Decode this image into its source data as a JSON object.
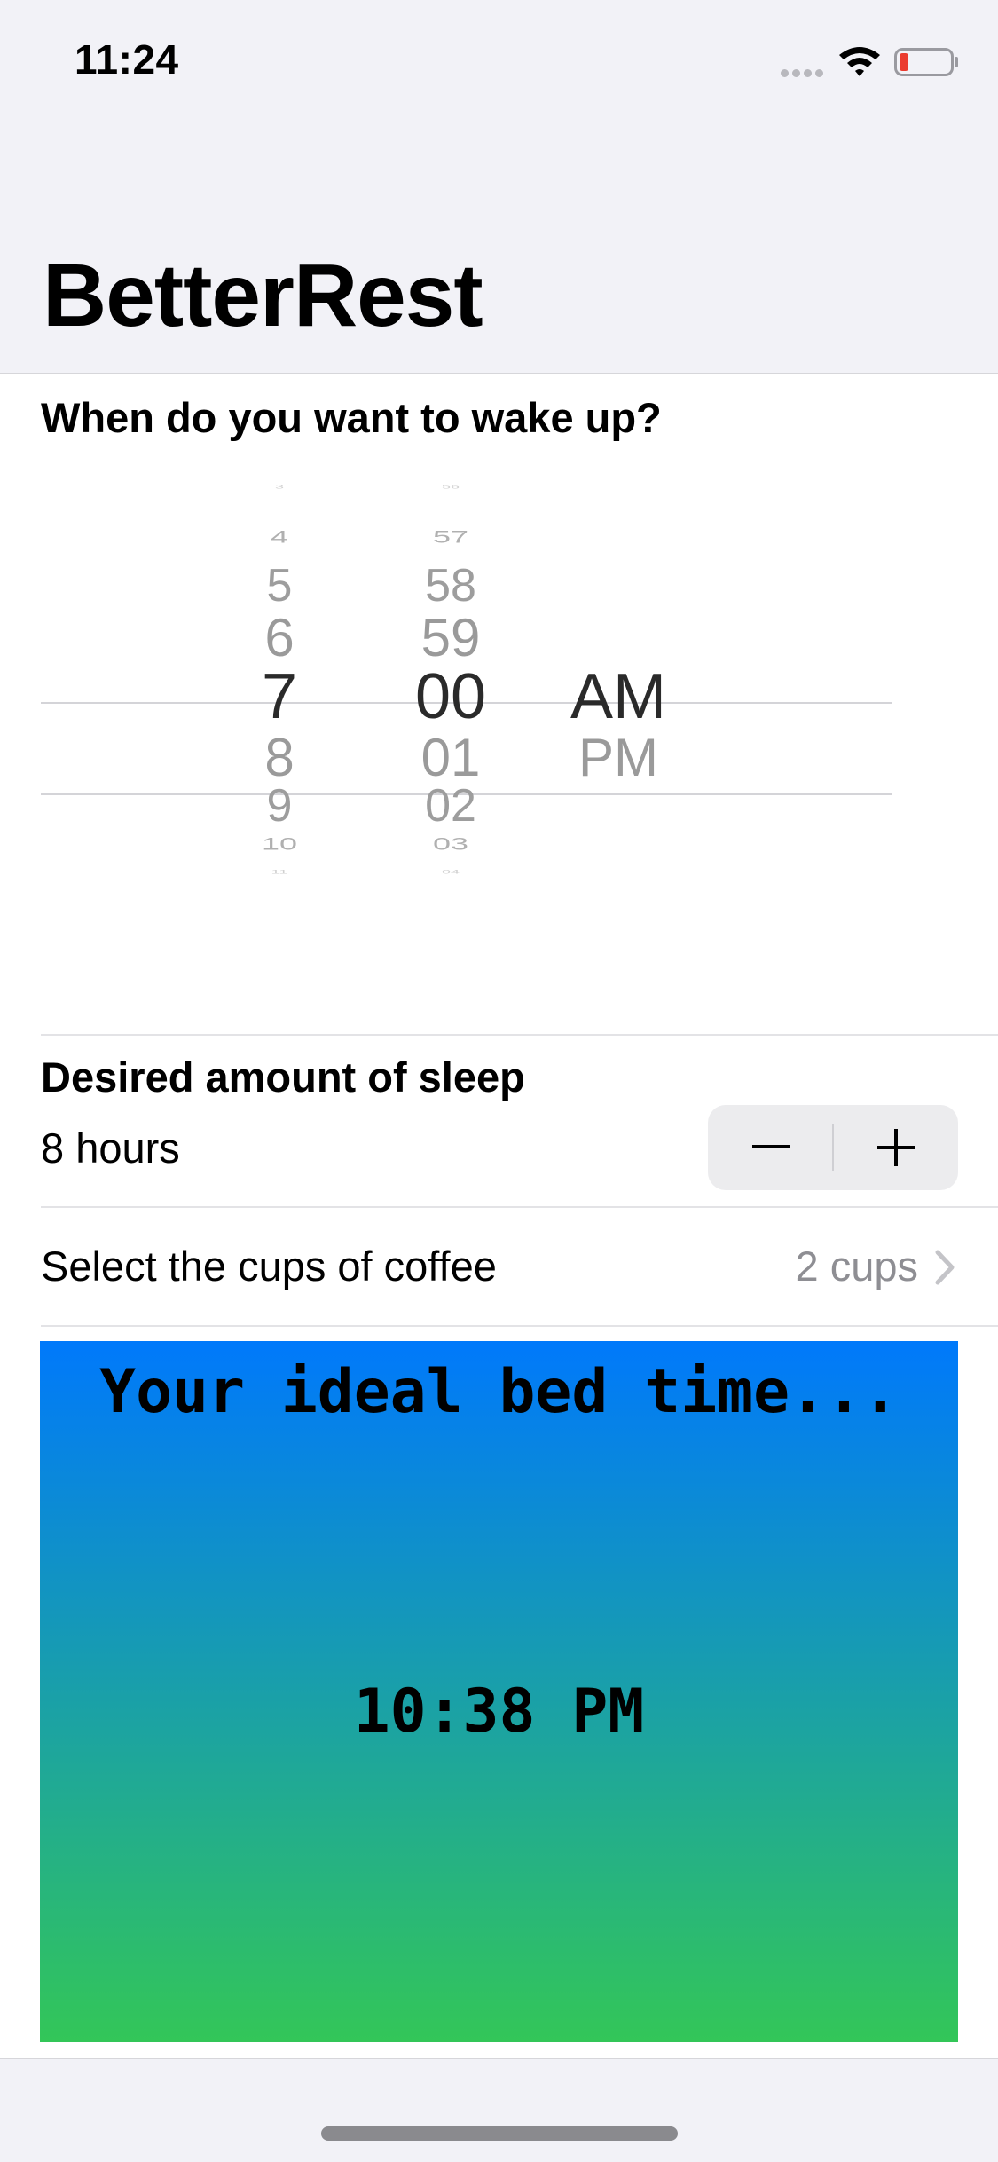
{
  "status_bar": {
    "time": "11:24",
    "signal_icon": "signal-dots-icon",
    "wifi_icon": "wifi-icon",
    "battery_icon": "battery-low-icon",
    "battery_color": "#eb3b2f"
  },
  "nav": {
    "title": "BetterRest"
  },
  "wake": {
    "label": "When do you want to wake up?",
    "picker": {
      "hours": [
        "3",
        "4",
        "5",
        "6",
        "7",
        "8",
        "9",
        "10",
        "11"
      ],
      "minutes": [
        "56",
        "57",
        "58",
        "59",
        "00",
        "01",
        "02",
        "03",
        "04"
      ],
      "periods": [
        "",
        "",
        "",
        "",
        "AM",
        "PM",
        "",
        "",
        ""
      ],
      "selected": {
        "hour": "7",
        "minute": "00",
        "period": "AM"
      }
    }
  },
  "sleep": {
    "label": "Desired amount of sleep",
    "value": "8 hours",
    "stepper_minus": "−",
    "stepper_plus": "+"
  },
  "coffee": {
    "label": "Select the cups of coffee",
    "value": "2 cups",
    "chevron_icon": "chevron-right-icon"
  },
  "result": {
    "title": "Your ideal bed time...",
    "time": "10:38 PM",
    "gradient_top": "#0079fb",
    "gradient_bottom": "#33c658"
  }
}
